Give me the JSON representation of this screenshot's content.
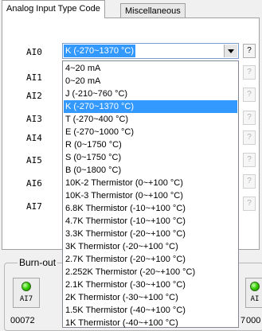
{
  "tabs": [
    {
      "label": "Analog Input Type Code"
    },
    {
      "label": "Miscellaneous"
    }
  ],
  "ai_labels": [
    "AI0",
    "AI1",
    "AI2",
    "AI3",
    "AI4",
    "AI5",
    "AI6",
    "AI7"
  ],
  "combo": {
    "value": "K (-270~1370 °C)"
  },
  "help_button": {
    "label": "?"
  },
  "dropdown_options": [
    "4~20 mA",
    "0~20 mA",
    "J (-210~760 °C)",
    "K (-270~1370 °C)",
    "T (-270~400 °C)",
    "E (-270~1000 °C)",
    "R (0~1750 °C)",
    "S (0~1750 °C)",
    "B (0~1800 °C)",
    "10K-2 Thermistor (0~+100 °C)",
    "10K-3 Thermistor (0~+100 °C)",
    "6.8K Thermistor (-10~+100 °C)",
    "4.7K Thermistor (-10~+100 °C)",
    "3.3K Thermistor (-20~+100 °C)",
    "3K Thermistor (-20~+100 °C)",
    "2.7K Thermistor (-20~+100 °C)",
    "2.252K Thermistor (-20~+100 °C)",
    "2.1K Thermistor (-30~+100 °C)",
    "2K Thermistor (-30~+100 °C)",
    "1.5K Thermistor (-40~+100 °C)",
    "1K Thermistor (-40~+100 °C)"
  ],
  "selected_option_index": 3,
  "burnout": {
    "title": "Burn-out",
    "left": {
      "label": "AI7",
      "code": "00072"
    },
    "right": {
      "label": "AI",
      "code": "000"
    },
    "partial_digit": "7"
  },
  "colors": {
    "selection": "#3399ff",
    "led": "#33cc00"
  }
}
